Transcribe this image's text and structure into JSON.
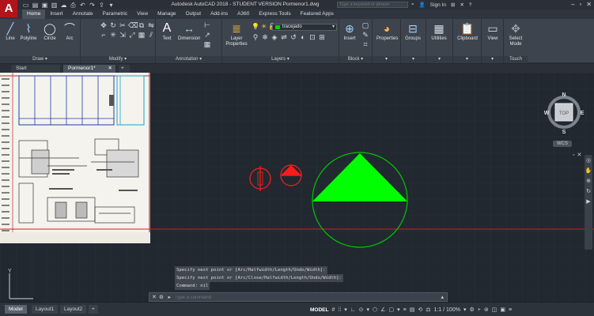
{
  "window": {
    "title": "Autodesk AutoCAD 2018 - STUDENT VERSION    Pormenor1.dwg",
    "search_placeholder": "Type a keyword or phrase",
    "sign_in": "Sign In",
    "logo": "A"
  },
  "ribbon_tabs": [
    "Home",
    "Insert",
    "Annotate",
    "Parametric",
    "View",
    "Manage",
    "Output",
    "Add-ins",
    "A360",
    "Express Tools",
    "Featured Apps"
  ],
  "ribbon": {
    "draw": {
      "title": "Draw ▾",
      "tools": [
        "Line",
        "Polyline",
        "Circle",
        "Arc"
      ]
    },
    "modify": {
      "title": "Modify ▾"
    },
    "annotation": {
      "title": "Annotation ▾",
      "tools": [
        "Text",
        "Dimension"
      ]
    },
    "layers": {
      "title": "Layers ▾",
      "properties_label": "Layer Properties",
      "current_layer": "tracejado",
      "current_layer_color": "#00d100"
    },
    "block": {
      "title": "Block ▾",
      "insert_label": "Insert"
    },
    "properties_label": "Properties",
    "groups_label": "Groups",
    "utilities_label": "Utilities",
    "clipboard_label": "Clipboard",
    "view_label": "View",
    "touch": {
      "title": "Touch",
      "label": "Select Mode"
    }
  },
  "file_tabs": [
    "Start",
    "Pormenor1*"
  ],
  "canvas": {
    "background": "#212830",
    "viewcube": {
      "top": "TOP",
      "n": "N",
      "s": "S",
      "e": "E",
      "w": "W",
      "wcs": "WCS"
    },
    "crosshair_color": "#d21f1f",
    "triangle_color": "#00ff00",
    "circle_color": "#00c800"
  },
  "command": {
    "history": [
      "Specify next point or [Arc/Halfwidth/Length/Undo/Width]:",
      "Specify next point or [Arc/Close/Halfwidth/Length/Undo/Width]:",
      "Command: nil"
    ],
    "placeholder": "Type a command"
  },
  "status": {
    "layout_tabs": [
      "Model",
      "Layout1",
      "Layout2"
    ],
    "mode": "MODEL",
    "scale": "1:1 / 100%"
  },
  "ucs": {
    "y": "Y"
  }
}
